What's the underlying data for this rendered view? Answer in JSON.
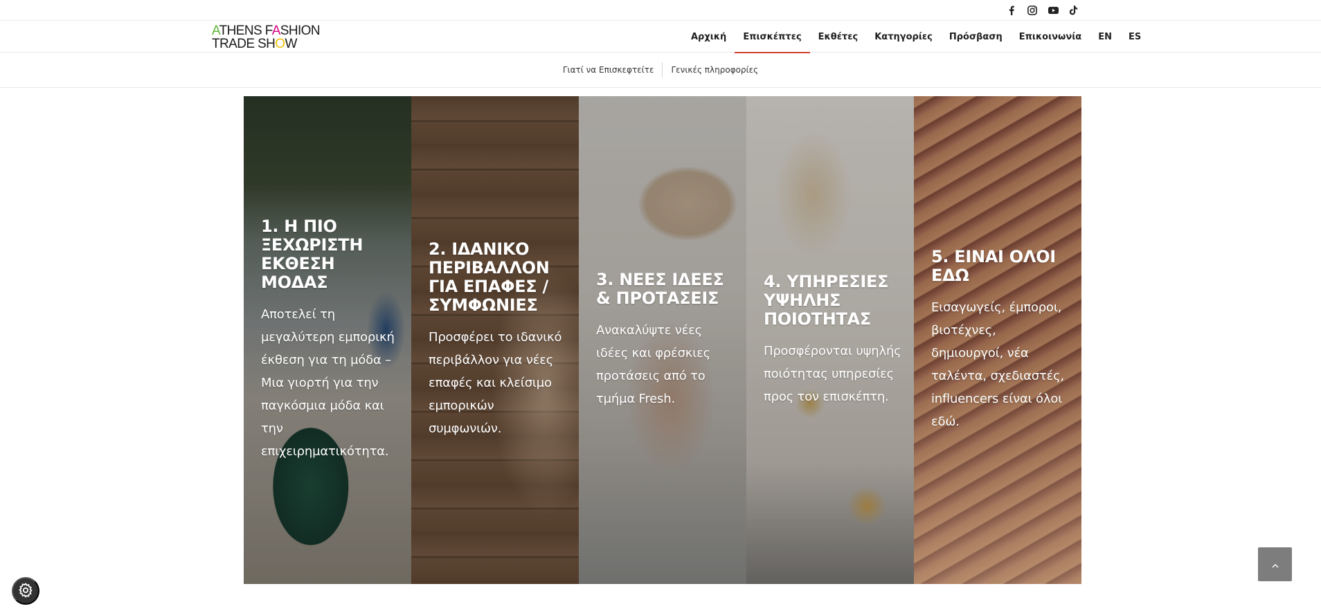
{
  "social": {
    "icons": [
      "facebook-icon",
      "instagram-icon",
      "youtube-icon",
      "tiktok-icon"
    ]
  },
  "logo": {
    "line1": "ATHENS FASHION",
    "line2": "TRADE SHOW",
    "colors": {
      "green": "#5bb335",
      "yellow": "#f2c200",
      "magenta": "#d6007e"
    }
  },
  "nav": {
    "items": [
      "Αρχική",
      "Επισκέπτες",
      "Εκθέτες",
      "Κατηγορίες",
      "Πρόσβαση",
      "Επικοινωνία",
      "EN",
      "ES"
    ],
    "active": "Επισκέπτες",
    "accent": "#d2402e"
  },
  "subnav": {
    "items": [
      "Γιατί να Επισκεφτείτε",
      "Γενικές πληροφορίες"
    ]
  },
  "panels": [
    {
      "title": "1. Η ΠΙΟ ΞΕΧΩΡΙΣΤΗ ΕΚΘΕΣΗ ΜΟΔΑΣ",
      "text": "Αποτελεί τη μεγαλύτερη εμπορική έκθεση για τη μόδα – Μια γιορτή για την παγκόσμια μόδα και την επιχειρηματικότητα."
    },
    {
      "title": "2. ΙΔΑΝΙΚΟ ΠΕΡΙΒΑΛΛΟΝ ΓΙΑ ΕΠΑΦΕΣ / ΣΥΜΦΩΝΙΕΣ",
      "text": "Προσφέρει το ιδανικό περιβάλλον για νέες επαφές και κλείσιμο εμπορικών συμφωνιών."
    },
    {
      "title": "3. ΝΕΕΣ ΙΔΕΕΣ & ΠΡΟΤΑΣΕΙΣ",
      "text": "Ανακαλύψτε νέες ιδέες και φρέσκιες προτάσεις από το τμήμα Fresh."
    },
    {
      "title": "4. ΥΠΗΡΕΣΙΕΣ ΥΨΗΛΗΣ ΠΟΙΟΤΗΤΑΣ",
      "text": "Προσφέρονται υψηλής ποιότητας υπηρεσίες προς τον επισκέπτη."
    },
    {
      "title": "5. ΕΙΝΑΙ ΟΛΟΙ ΕΔΩ",
      "text": "Εισαγωγείς, έμποροι, βιοτέχνες, δημιουργοί, νέα ταλέντα, σχεδιαστές, influencers είναι όλοι εδώ."
    }
  ],
  "widgets": {
    "cookie": "gear-icon",
    "scroll_top": "chevron-up-icon"
  }
}
